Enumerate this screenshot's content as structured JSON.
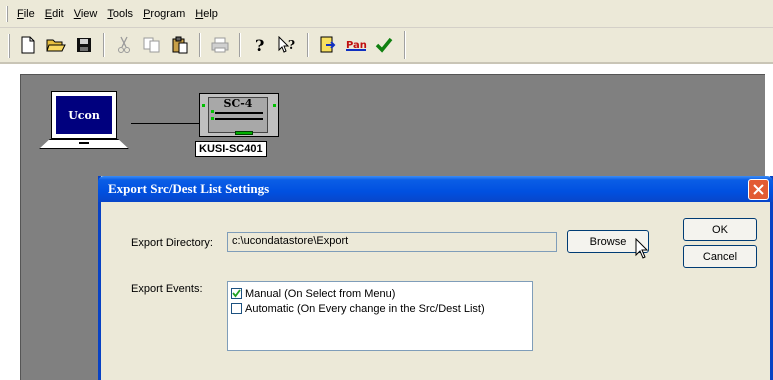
{
  "menu": [
    {
      "key": "F",
      "rest": "ile"
    },
    {
      "key": "E",
      "rest": "dit"
    },
    {
      "key": "V",
      "rest": "iew"
    },
    {
      "key": "T",
      "rest": "ools"
    },
    {
      "key": "P",
      "rest": "rogram"
    },
    {
      "key": "H",
      "rest": "elp"
    }
  ],
  "toolbar_icons": [
    "new-file-icon",
    "open-folder-icon",
    "save-icon",
    "cut-icon",
    "copy-icon",
    "paste-icon",
    "print-icon",
    "help-icon",
    "context-help-icon",
    "program-icon",
    "pan-icon",
    "check-icon"
  ],
  "canvas": {
    "laptop_label": "Ucon",
    "device_title": "SC-4",
    "device_label": "KUSI-SC401"
  },
  "dialog": {
    "title": "Export Src/Dest List Settings",
    "dir_label": "Export Directory:",
    "dir_value": "c:\\ucondatastore\\Export",
    "browse_label": "Browse",
    "ok_label": "OK",
    "cancel_label": "Cancel",
    "events_label": "Export Events:",
    "events": [
      {
        "label": "Manual (On Select from Menu)",
        "checked": true
      },
      {
        "label": "Automatic (On Every change in the Src/Dest List)",
        "checked": false
      }
    ]
  },
  "colors": {
    "titlebar": "#0050e0",
    "canvas": "#808080",
    "laptop_screen": "#00007e",
    "close": "#e25b33"
  }
}
